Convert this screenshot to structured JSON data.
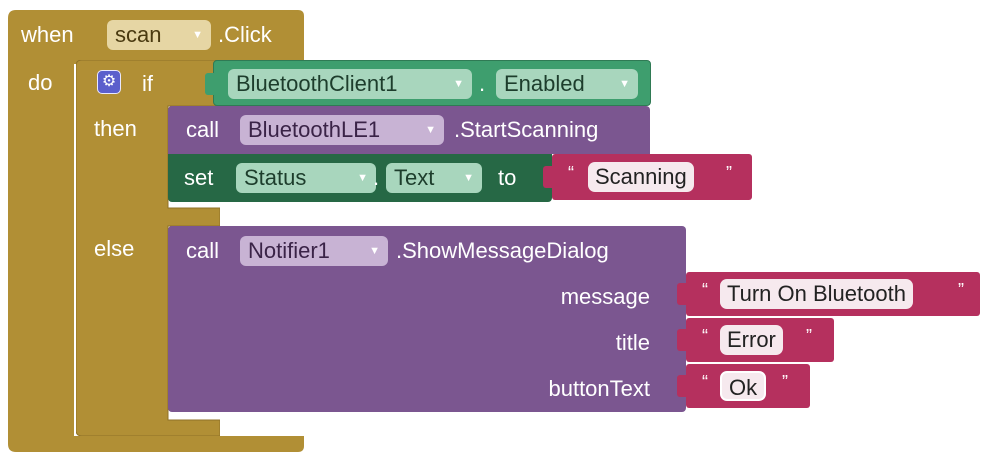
{
  "colors": {
    "control": "#b18f35",
    "logic_getter": "#3e9e6e",
    "logic_getter_dark": "#2f7a54",
    "procedure": "#7b5690",
    "setter": "#266845",
    "text": "#b5305e",
    "dropdown_light": "#e6d6a4",
    "purple_dd": "#c8b3d4",
    "green_dd": "#a8d6bd",
    "gear": "#5b5fcc"
  },
  "event": {
    "keyword": "when",
    "component": "scan",
    "event_name": ".Click",
    "do_label": "do"
  },
  "if_block": {
    "gear_icon": "gear-icon",
    "if_label": "if",
    "then_label": "then",
    "else_label": "else",
    "condition": {
      "component": "BluetoothClient1",
      "dot": ".",
      "property": "Enabled"
    }
  },
  "then_statements": {
    "call": {
      "keyword": "call",
      "component": "BluetoothLE1",
      "method": ".StartScanning"
    },
    "set": {
      "keyword": "set",
      "component": "Status",
      "dot": ".",
      "property": "Text",
      "to_label": "to",
      "value": "Scanning"
    }
  },
  "else_statement": {
    "keyword": "call",
    "component": "Notifier1",
    "method": ".ShowMessageDialog",
    "args": [
      {
        "label": "message",
        "value": "Turn On Bluetooth"
      },
      {
        "label": "title",
        "value": "Error"
      },
      {
        "label": "buttonText",
        "value": "Ok"
      }
    ]
  },
  "quote_open": "“",
  "quote_close": "”",
  "dropdown_arrow": "▼"
}
